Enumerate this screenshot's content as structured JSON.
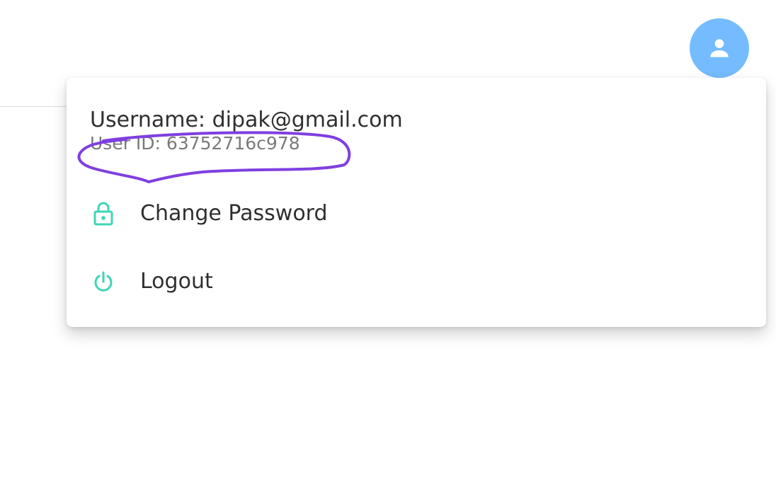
{
  "colors": {
    "avatar_background": "#74bcff",
    "icon_accent": "#3ed6b6",
    "annotation_stroke": "#7f3fe0",
    "text_primary": "#2f2f2f",
    "text_secondary": "#7a7a7a"
  },
  "header": {
    "avatar_icon": "user-icon"
  },
  "user_menu": {
    "username": "Username: dipak@gmail.com",
    "user_id": "User ID: 63752716c978",
    "items": [
      {
        "label": "Change Password",
        "icon": "lock-icon"
      },
      {
        "label": "Logout",
        "icon": "power-icon"
      }
    ]
  }
}
